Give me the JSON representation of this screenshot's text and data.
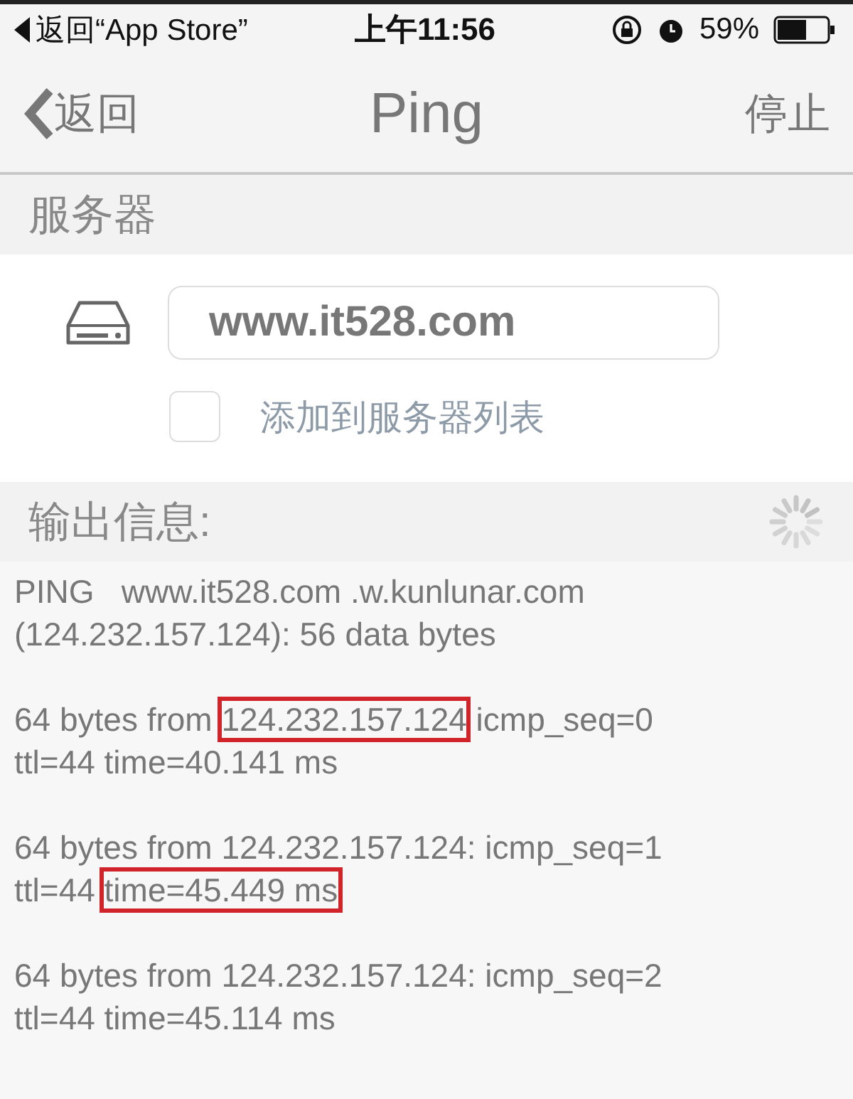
{
  "status_bar": {
    "back_label": "返回“App Store”",
    "time": "上午11:56",
    "battery": "59%"
  },
  "nav": {
    "back": "返回",
    "title": "Ping",
    "action": "停止"
  },
  "server_section": {
    "title": "服务器",
    "host_value": "www.it528.com",
    "add_to_list": {
      "label": "添加到服务器列表",
      "checked": false
    }
  },
  "output_section": {
    "title": "输出信息:",
    "loading": true,
    "blocks": [
      [
        [
          {
            "text": "PING   www.it528.com .w.kunlunar.com",
            "highlighted": false
          }
        ],
        [
          {
            "text": "(124.232.157.124): 56 data bytes",
            "highlighted": false
          }
        ]
      ],
      [
        [
          {
            "text": "64 bytes from ",
            "highlighted": false
          },
          {
            "text": "124.232.157.124",
            "highlighted": true
          },
          {
            "text": " icmp_seq=0",
            "highlighted": false
          }
        ],
        [
          {
            "text": "ttl=44 time=40.141 ms",
            "highlighted": false
          }
        ]
      ],
      [
        [
          {
            "text": "64 bytes from 124.232.157.124: icmp_seq=1",
            "highlighted": false
          }
        ],
        [
          {
            "text": "ttl=44 ",
            "highlighted": false
          },
          {
            "text": "time=45.449 ms",
            "highlighted": true
          }
        ]
      ],
      [
        [
          {
            "text": "64 bytes from 124.232.157.124: icmp_seq=2",
            "highlighted": false
          }
        ],
        [
          {
            "text": "ttl=44 time=45.114 ms",
            "highlighted": false
          }
        ]
      ]
    ]
  }
}
